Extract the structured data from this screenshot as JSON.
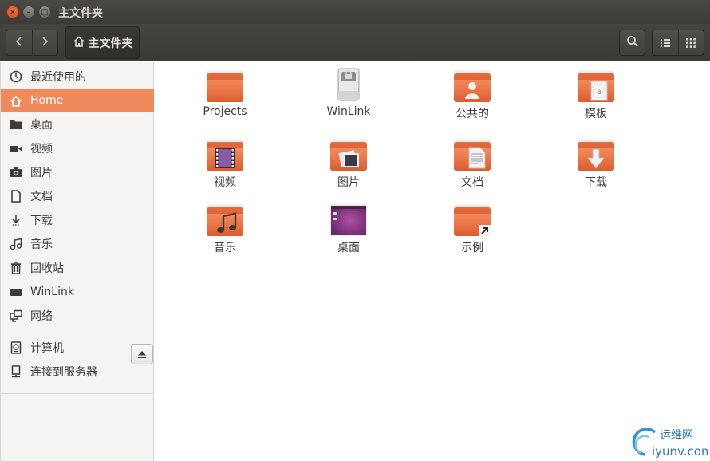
{
  "window": {
    "title": "主文件夹"
  },
  "toolbar": {
    "back_glyph": "‹",
    "forward_glyph": "›",
    "path_label": "主文件夹"
  },
  "sidebar": {
    "items": [
      {
        "label": "最近使用的",
        "icon": "clock-icon"
      },
      {
        "label": "Home",
        "icon": "home-icon",
        "active": true
      },
      {
        "label": "桌面",
        "icon": "folder-icon"
      },
      {
        "label": "视频",
        "icon": "video-icon"
      },
      {
        "label": "图片",
        "icon": "camera-icon"
      },
      {
        "label": "文档",
        "icon": "document-icon"
      },
      {
        "label": "下载",
        "icon": "download-icon"
      },
      {
        "label": "音乐",
        "icon": "music-icon"
      },
      {
        "label": "回收站",
        "icon": "trash-icon"
      },
      {
        "label": "WinLink",
        "icon": "drive-icon"
      },
      {
        "label": "网络",
        "icon": "network-icon"
      },
      {
        "label": "计算机",
        "icon": "computer-icon"
      },
      {
        "label": "连接到服务器",
        "icon": "server-icon"
      }
    ]
  },
  "files": [
    {
      "name": "Projects",
      "icon": "plain-folder-icon"
    },
    {
      "name": "WinLink",
      "icon": "usb-drive-icon"
    },
    {
      "name": "公共的",
      "icon": "public-folder-icon"
    },
    {
      "name": "模板",
      "icon": "templates-folder-icon"
    },
    {
      "name": "视频",
      "icon": "videos-folder-icon"
    },
    {
      "name": "图片",
      "icon": "pictures-folder-icon"
    },
    {
      "name": "文档",
      "icon": "documents-folder-icon"
    },
    {
      "name": "下载",
      "icon": "downloads-folder-icon"
    },
    {
      "name": "音乐",
      "icon": "music-folder-icon"
    },
    {
      "name": "桌面",
      "icon": "desktop-folder-icon"
    },
    {
      "name": "示例",
      "icon": "examples-folder-icon"
    }
  ],
  "watermark": {
    "title": "运维网",
    "url": "iyunv.com"
  },
  "colors": {
    "accent": "#f08a5d",
    "folder": "#e4622f",
    "titlebar": "#3c3b37"
  }
}
